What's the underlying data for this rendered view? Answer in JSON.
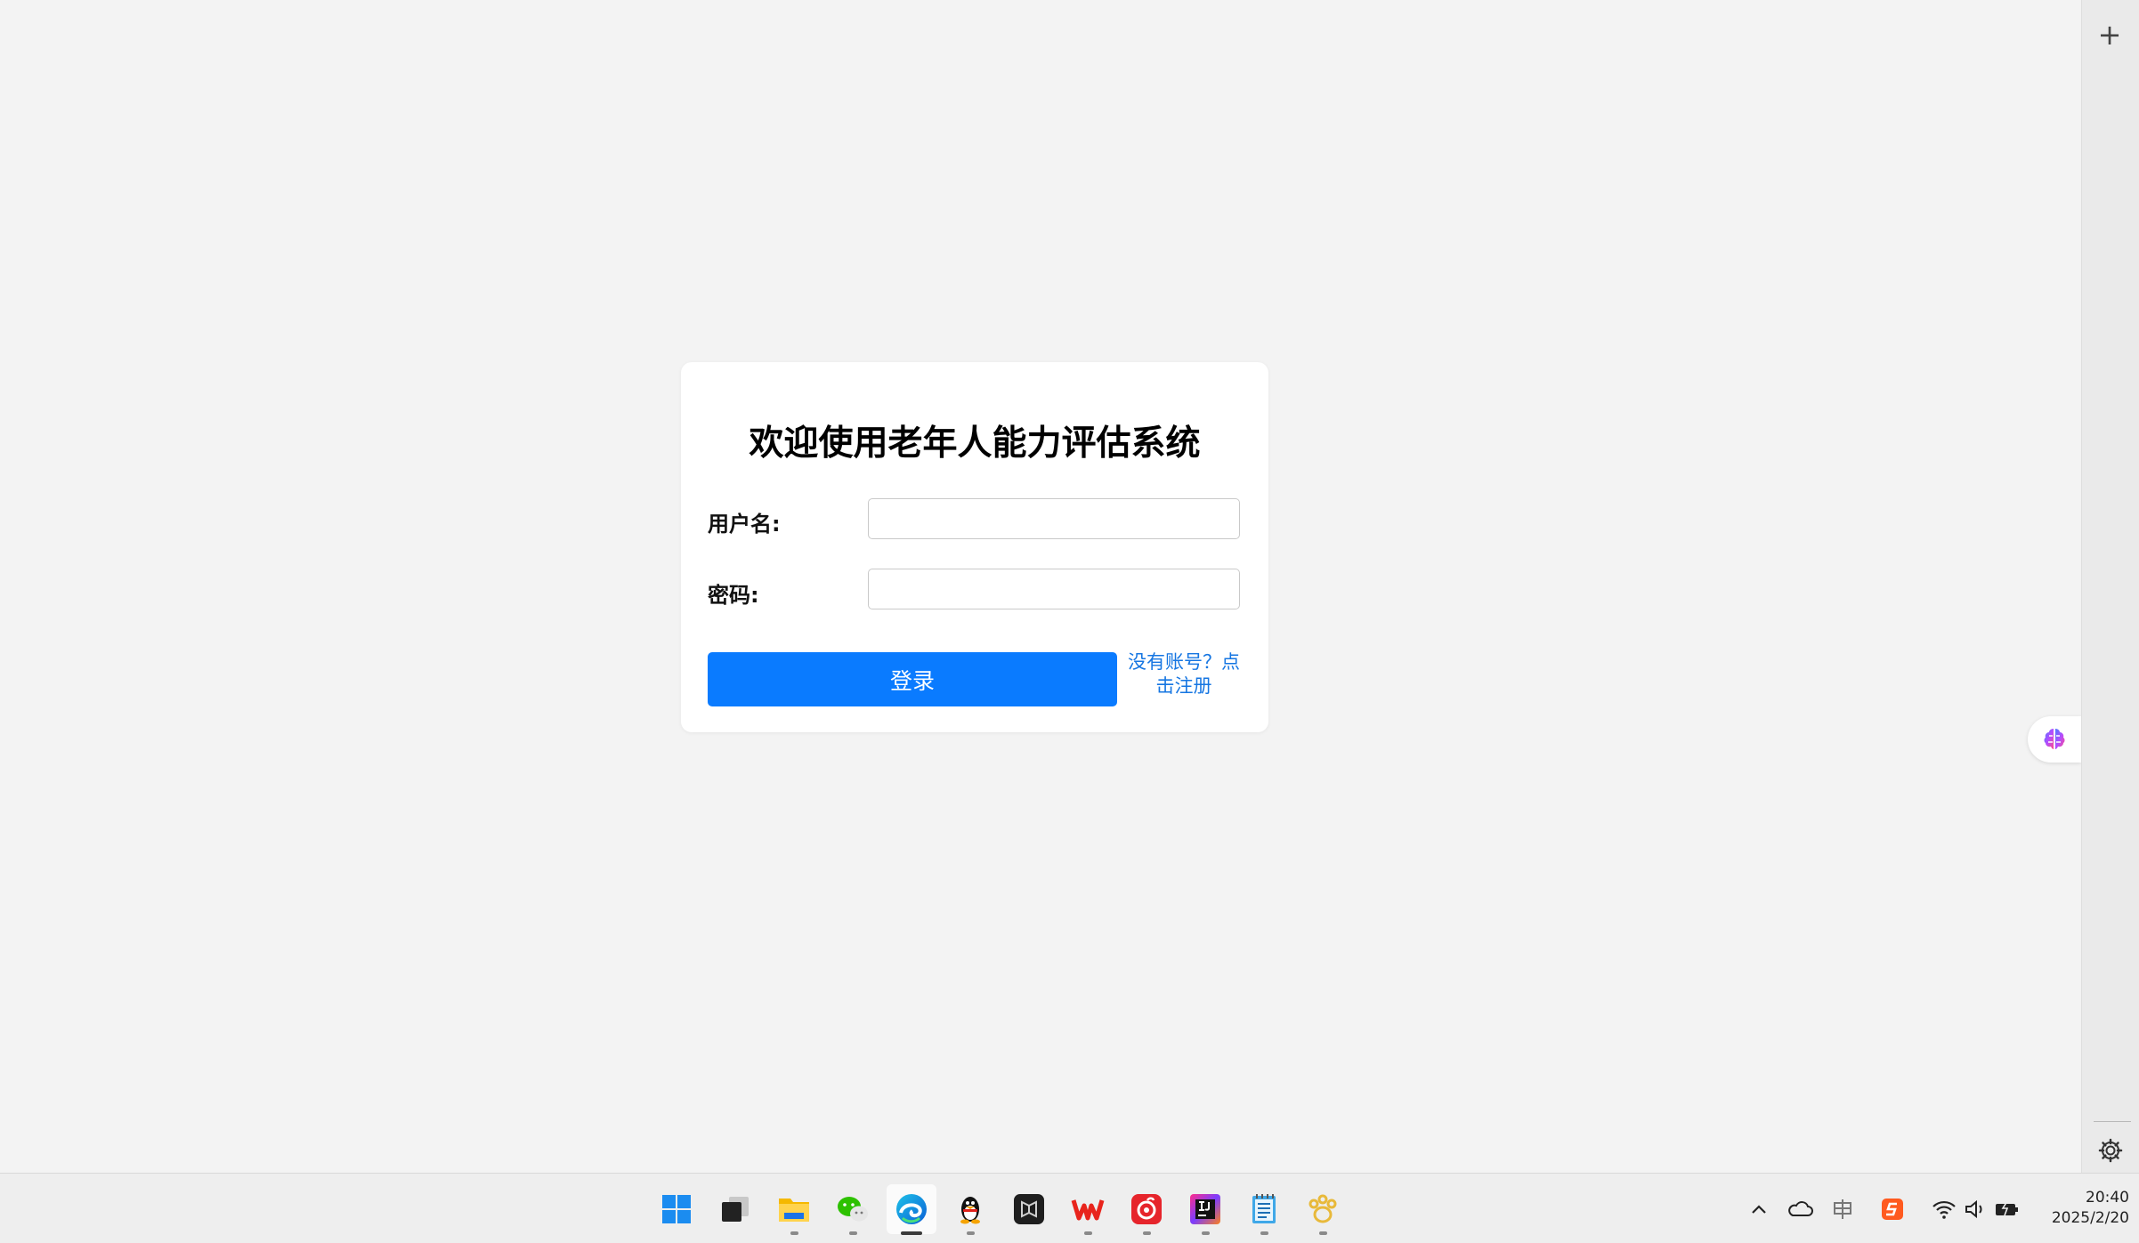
{
  "login": {
    "title": "欢迎使用老年人能力评估系统",
    "username_label": "用户名:",
    "username_value": "",
    "password_label": "密码:",
    "password_value": "",
    "login_button": "登录",
    "register_line1": "没有账号？点",
    "register_line2": "击注册"
  },
  "colors": {
    "primary": "#0a7bff",
    "link": "#1676e2",
    "background": "#f3f3f3"
  },
  "taskbar": {
    "apps": [
      {
        "name": "start-icon",
        "running": false
      },
      {
        "name": "task-view-icon",
        "running": false
      },
      {
        "name": "file-explorer-icon",
        "running": true
      },
      {
        "name": "wechat-icon",
        "running": true
      },
      {
        "name": "edge-icon",
        "running": true,
        "active": true
      },
      {
        "name": "qq-icon",
        "running": true
      },
      {
        "name": "dark-app-icon",
        "running": false
      },
      {
        "name": "wps-icon",
        "running": true
      },
      {
        "name": "netease-music-icon",
        "running": true
      },
      {
        "name": "intellij-idea-icon",
        "running": true
      },
      {
        "name": "notepad-icon",
        "running": true
      },
      {
        "name": "paw-app-icon",
        "running": true
      }
    ],
    "tray": [
      "chevron-up-icon",
      "onedrive-icon",
      "input-method-icon",
      "sogou-icon",
      "wifi-icon",
      "volume-icon",
      "battery-icon"
    ],
    "time": "20:40",
    "date": "2025/2/20"
  }
}
